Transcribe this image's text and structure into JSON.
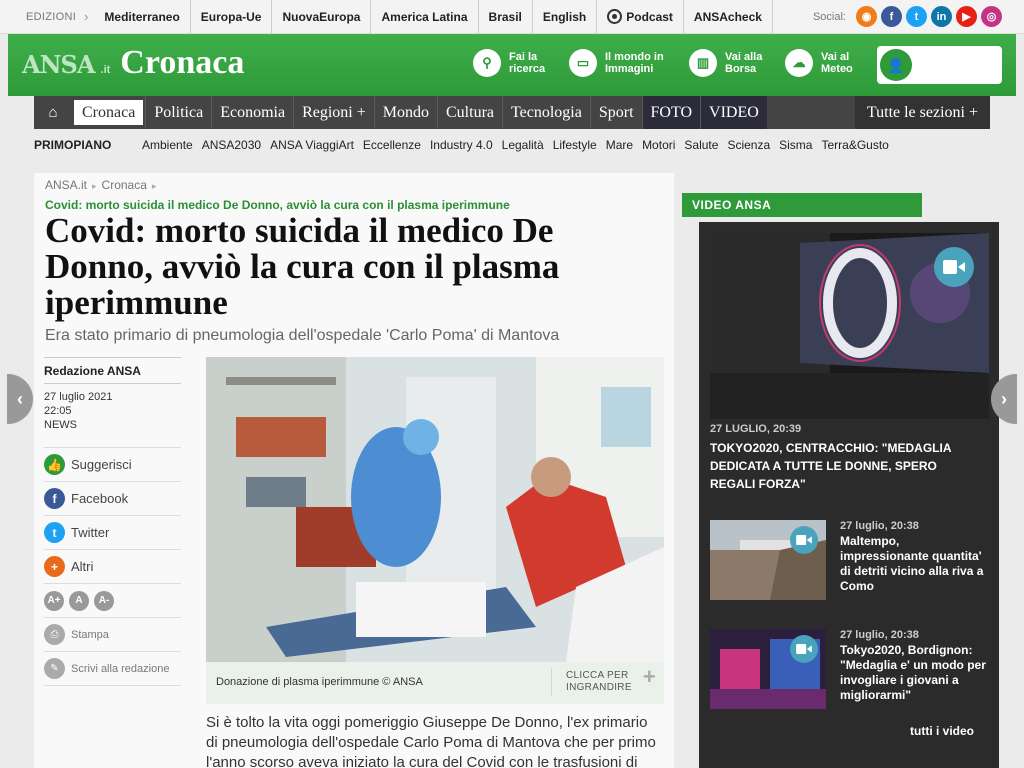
{
  "topbar": {
    "editions_label": "EDIZIONI",
    "items": [
      "Mediterraneo",
      "Europa-Ue",
      "NuovaEuropa",
      "America Latina",
      "Brasil",
      "English",
      "Podcast",
      "ANSAcheck"
    ],
    "social_label": "Social:"
  },
  "header": {
    "brand": "ANSA",
    "brand_suffix": ".it",
    "section": "Cronaca",
    "links": [
      {
        "label": "Fai la ricerca",
        "icon": "search-icon"
      },
      {
        "label": "Il mondo in Immagini",
        "icon": "monitor-icon"
      },
      {
        "label": "Vai alla Borsa",
        "icon": "chart-icon"
      },
      {
        "label": "Vai al Meteo",
        "icon": "weather-icon"
      }
    ]
  },
  "nav": {
    "items": [
      "Cronaca",
      "Politica",
      "Economia",
      "Regioni +",
      "Mondo",
      "Cultura",
      "Tecnologia",
      "Sport",
      "FOTO",
      "VIDEO"
    ],
    "more": "Tutte le sezioni +"
  },
  "subnav": {
    "label": "PRIMOPIANO",
    "items": [
      "Ambiente",
      "ANSA2030",
      "ANSA ViaggiArt",
      "Eccellenze",
      "Industry 4.0",
      "Legalità",
      "Lifestyle",
      "Mare",
      "Motori",
      "Salute",
      "Scienza",
      "Sisma",
      "Terra&Gusto"
    ]
  },
  "article": {
    "breadcrumb": [
      "ANSA.it",
      "Cronaca"
    ],
    "kicker": "Covid: morto suicida il medico De Donno, avviò la cura con il plasma iperimmune",
    "title": "Covid: morto suicida il medico De Donno, avviò la cura con il plasma iperimmune",
    "subtitle": "Era stato primario di pneumologia dell'ospedale 'Carlo Poma' di Mantova",
    "author": "Redazione ANSA",
    "date": "27 luglio 2021",
    "time": "22:05",
    "type": "NEWS",
    "share": [
      "Suggerisci",
      "Facebook",
      "Twitter",
      "Altri"
    ],
    "font_buttons": [
      "A+",
      "A",
      "A-"
    ],
    "tools": [
      "Stampa",
      "Scrivi alla redazione"
    ],
    "caption": "Donazione di plasma iperimmune © ANSA",
    "zoom_label": "CLICCA PER INGRANDIRE",
    "body": "Si è tolto la vita oggi pomeriggio Giuseppe De Donno, l'ex primario di pneumologia dell'ospedale Carlo Poma di Mantova che per primo l'anno scorso aveva iniziato la cura del Covid con le trasfusioni di"
  },
  "sidebar": {
    "tab": "VIDEO ANSA",
    "featured": {
      "date": "27 LUGLIO, 20:39",
      "title": "TOKYO2020, CENTRACCHIO: \"MEDAGLIA DEDICATA A TUTTE LE DONNE, SPERO REGALI FORZA\""
    },
    "videos": [
      {
        "date": "27 luglio, 20:38",
        "title": "Maltempo, impressionante quantita' di detriti vicino alla riva a Como"
      },
      {
        "date": "27 luglio, 20:38",
        "title": "Tokyo2020, Bordignon: \"Medaglia e' un modo per invogliare i giovani a migliorarmi\""
      }
    ],
    "all_label": "tutti i video"
  },
  "colors": {
    "brand_green": "#2e9a3a",
    "nav_dark": "#444444",
    "video_bg": "#2b2b2b"
  }
}
